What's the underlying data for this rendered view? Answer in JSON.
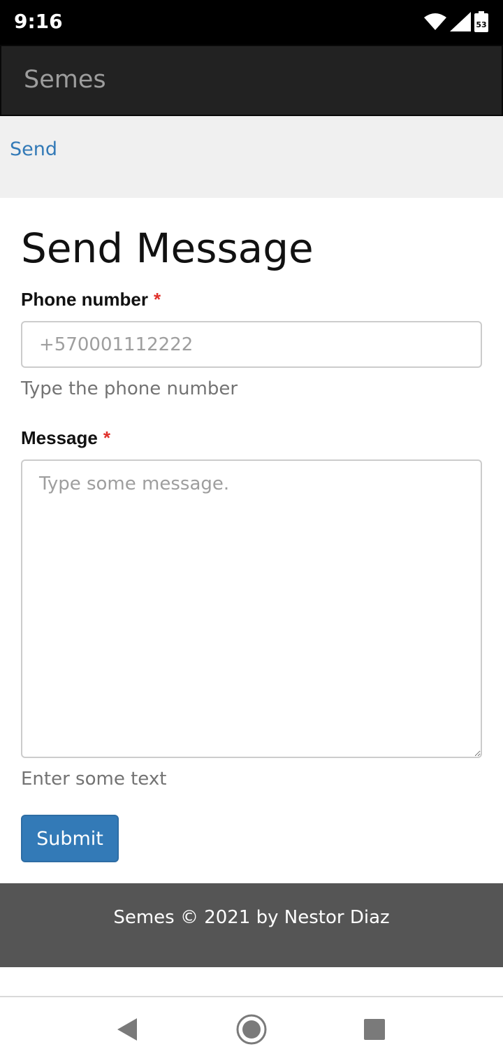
{
  "status_bar": {
    "time": "9:16",
    "icons": [
      "wifi-icon",
      "signal-icon",
      "battery-icon"
    ],
    "battery_level": "53"
  },
  "navbar": {
    "brand": "Semes"
  },
  "breadcrumb": {
    "item": "Send"
  },
  "page": {
    "title": "Send Message",
    "phone": {
      "label": "Phone number",
      "required_mark": "*",
      "placeholder": "+570001112222",
      "value": "",
      "help": "Type the phone number"
    },
    "message": {
      "label": "Message",
      "required_mark": "*",
      "placeholder": "Type some message.",
      "value": "",
      "help": "Enter some text"
    },
    "submit_label": "Submit"
  },
  "footer": {
    "text": "Semes © 2021 by Nestor Diaz"
  },
  "system_nav": {
    "buttons": [
      "back-icon",
      "home-icon",
      "recents-icon"
    ]
  },
  "colors": {
    "accent": "#337ab7",
    "navbar_bg": "#222222",
    "footer_bg": "#555555",
    "required": "#e0312b"
  }
}
